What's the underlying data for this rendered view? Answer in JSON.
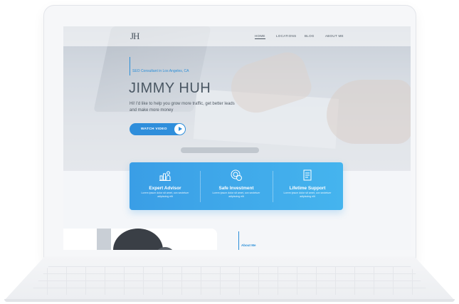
{
  "site": {
    "logo": "JH",
    "nav": [
      {
        "label": "HOME",
        "active": true
      },
      {
        "label": "LOCATIONS",
        "active": false
      },
      {
        "label": "BLOG",
        "active": false
      },
      {
        "label": "ABOUT ME",
        "active": false
      }
    ]
  },
  "hero": {
    "eyebrow": "SEO Consultant in Los Angeles, CA",
    "title": "JIMMY HUH",
    "subtitle": "Hi! I'd like to help you grow more traffic, get better leads and make more money",
    "cta_label": "WATCH VIDEO"
  },
  "features": [
    {
      "icon": "bar-chart-person-icon",
      "title": "Expert Advisor",
      "desc": "Lorem ipsum dolor sit amet, con sectetuer adipiscing elit"
    },
    {
      "icon": "safe-coins-icon",
      "title": "Safe Investment",
      "desc": "Lorem ipsum dolor sit amet, con sectetuer adipiscing elit"
    },
    {
      "icon": "document-support-icon",
      "title": "Lifetime Support",
      "desc": "Lorem ipsum dolor sit amet, con sectetuer adipiscing elit"
    }
  ],
  "about": {
    "label": "About Me"
  },
  "colors": {
    "accent": "#2f8edb",
    "card_start": "#3a9ee6",
    "card_end": "#45b4ee"
  }
}
